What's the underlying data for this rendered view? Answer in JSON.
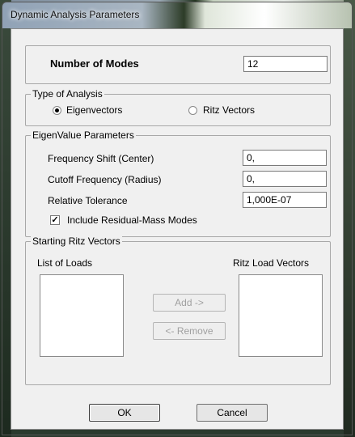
{
  "window": {
    "title": "Dynamic Analysis Parameters"
  },
  "modes": {
    "label": "Number of Modes",
    "value": "12"
  },
  "analysis_type": {
    "legend": "Type of Analysis",
    "options": [
      {
        "label": "Eigenvectors",
        "selected": true
      },
      {
        "label": "Ritz Vectors",
        "selected": false
      }
    ]
  },
  "eigen": {
    "legend": "EigenValue Parameters",
    "frequency_shift": {
      "label": "Frequency Shift  (Center)",
      "value": "0,"
    },
    "cutoff_frequency": {
      "label": "Cutoff Frequency  (Radius)",
      "value": "0,"
    },
    "relative_tolerance": {
      "label": "Relative Tolerance",
      "value": "1,000E-07"
    },
    "residual_mass": {
      "label": "Include Residual-Mass Modes",
      "checked": true,
      "check_glyph": "✓"
    }
  },
  "ritz": {
    "legend": "Starting Ritz Vectors",
    "list_of_loads_label": "List of Loads",
    "ritz_load_vectors_label": "Ritz Load Vectors",
    "add_label": "Add ->",
    "remove_label": "<- Remove"
  },
  "buttons": {
    "ok": "OK",
    "cancel": "Cancel"
  }
}
